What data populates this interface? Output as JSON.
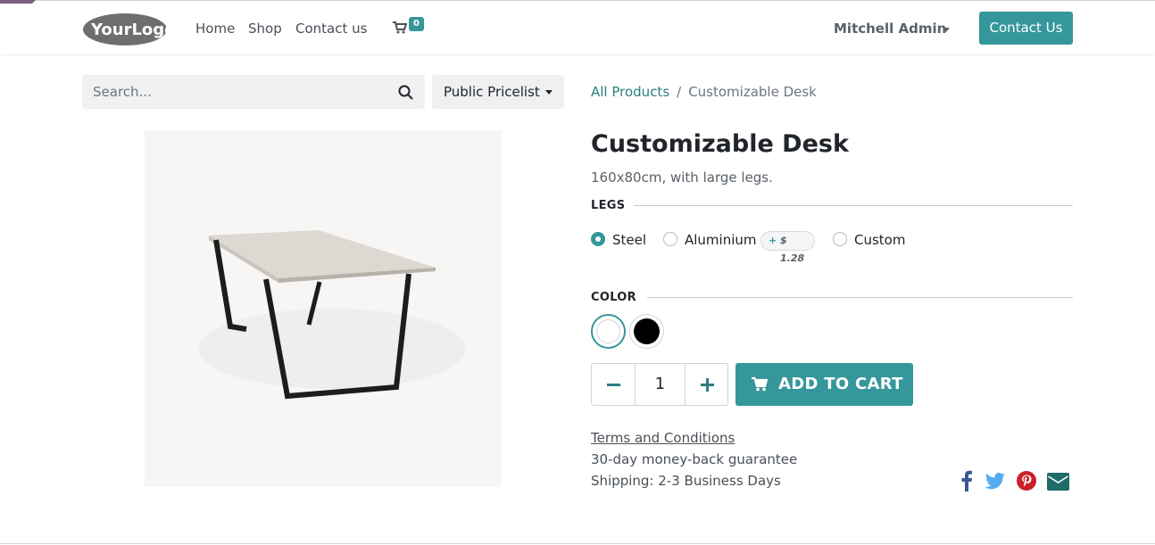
{
  "header": {
    "logo_text": "YourLogo",
    "nav": [
      {
        "label": "Home"
      },
      {
        "label": "Shop"
      },
      {
        "label": "Contact us"
      }
    ],
    "cart_count": "0",
    "user_name": "Mitchell Admin",
    "contact_button": "Contact Us"
  },
  "search": {
    "placeholder": "Search...",
    "pricelist": "Public Pricelist"
  },
  "breadcrumb": {
    "parent": "All Products",
    "separator": "/",
    "current": "Customizable Desk"
  },
  "product": {
    "name": "Customizable Desk",
    "description": "160x80cm, with large legs.",
    "attributes": {
      "legs": {
        "label": "LEGS",
        "options": [
          "Steel",
          "Aluminium",
          "Custom"
        ],
        "selected": "Steel",
        "price_extra": {
          "sign": "+",
          "amount": "$ 1.28"
        }
      },
      "color": {
        "label": "COLOR",
        "options": [
          {
            "name": "White",
            "hex": "#ffffff",
            "selected": true
          },
          {
            "name": "Black",
            "hex": "#000000",
            "selected": false
          }
        ]
      }
    },
    "quantity": "1",
    "add_to_cart": "ADD TO CART",
    "terms": "Terms and Conditions",
    "guarantee": "30-day money-back guarantee",
    "shipping": "Shipping: 2-3 Business Days"
  },
  "share_icons": [
    "facebook-icon",
    "twitter-icon",
    "pinterest-icon",
    "email-icon"
  ],
  "colors": {
    "primary": "#35979c",
    "corner": "#7c5f7f",
    "facebook": "#3b5998",
    "twitter": "#55acee",
    "pinterest": "#cb2027",
    "email": "#1f6c68"
  }
}
